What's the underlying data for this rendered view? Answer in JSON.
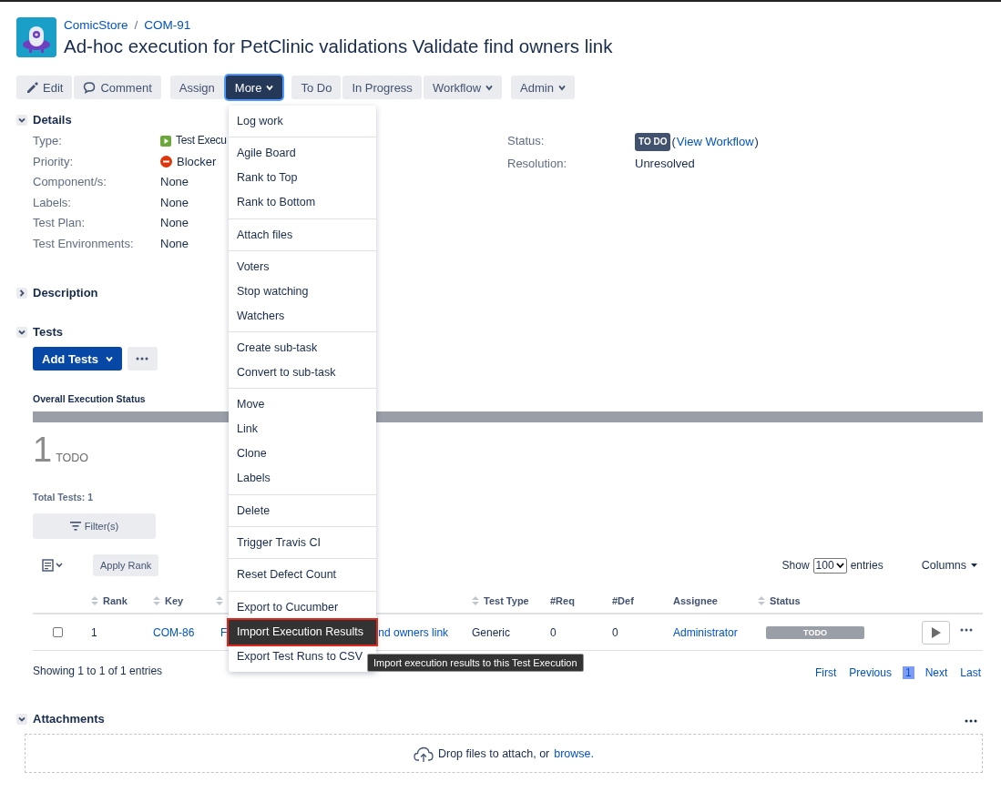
{
  "breadcrumb": [
    "ComicStore",
    "/",
    "COM-91"
  ],
  "title": "Ad-hoc execution for PetClinic validations Validate find owners link",
  "toolbar": [
    [
      {
        "label": "Edit",
        "kind": "edit",
        "selected": false
      },
      {
        "label": "Comment",
        "kind": "comment",
        "selected": false
      }
    ],
    [
      {
        "label": "Assign",
        "kind": "plain",
        "selected": false
      },
      {
        "label": "More",
        "kind": "dropdown",
        "selected": true
      }
    ],
    [
      {
        "label": "To Do",
        "kind": "plain",
        "selected": false
      },
      {
        "label": "In Progress",
        "kind": "plain",
        "selected": false
      },
      {
        "label": "Workflow",
        "kind": "dropdown",
        "selected": false
      }
    ],
    [
      {
        "label": "Admin",
        "kind": "dropdown",
        "selected": false
      }
    ]
  ],
  "details": {
    "title": "Details",
    "expanded": true,
    "fields": [
      {
        "label": "Type:",
        "kind": "test-execution",
        "value": "Test Execu"
      },
      {
        "label": "Priority:",
        "kind": "blocker",
        "value": "Blocker"
      },
      {
        "label": "Component/s:",
        "kind": "plain",
        "value": "None"
      },
      {
        "label": "Labels:",
        "kind": "plain",
        "value": "None"
      },
      {
        "label": "Test Plan:",
        "kind": "plain",
        "value": "None"
      },
      {
        "label": "Test Environments:",
        "kind": "plain",
        "value": "None"
      }
    ],
    "side_fields": [
      {
        "label": "Status:",
        "kind": "status",
        "lozenge": "TO DO",
        "open": "(",
        "link": "View Workflow",
        "close": ")"
      },
      {
        "label": "Resolution:",
        "kind": "plain",
        "value": "Unresolved"
      }
    ]
  },
  "description": {
    "title": "Description",
    "expanded": false
  },
  "tests": {
    "title": "Tests",
    "expanded": true,
    "add_button": "Add Tests",
    "overall_label": "Overall Execution Status",
    "level": 1,
    "count": "1",
    "count_status": "TODO",
    "total": "Total Tests: 1",
    "filter_button": "Filter(s)",
    "apply_rank": "Apply Rank",
    "show_label": "Show",
    "page_size": "100",
    "entries_label": "entries",
    "columns_button": "Columns",
    "table": {
      "columns": [
        {
          "label": "Rank",
          "sortable": true
        },
        {
          "label": "Key",
          "sortable": true
        },
        {
          "sortable": true
        },
        {
          "label": "Test Type",
          "sortable": true
        },
        {
          "label": "#Req",
          "sortable": false
        },
        {
          "label": "#Def",
          "sortable": false
        },
        {
          "label": "Assignee",
          "sortable": false
        },
        {
          "label": "Status",
          "sortable": true
        }
      ],
      "rows": [
        {
          "checked": false,
          "rank": "1",
          "key": "COM-86",
          "summary_parts": [
            "F",
            "nd owners link"
          ],
          "test_type": "Generic",
          "req": "0",
          "def": "0",
          "assignee": "Administrator",
          "status": "TODO"
        }
      ]
    },
    "showing": "Showing 1 to 1 of 1 entries",
    "pagination": [
      {
        "label": "First",
        "selected": false
      },
      {
        "label": "Previous",
        "selected": false
      },
      {
        "label": "1",
        "selected": true
      },
      {
        "label": "Next",
        "selected": false
      },
      {
        "label": "Last",
        "selected": false
      }
    ]
  },
  "attachments": {
    "title": "Attachments",
    "expanded": true,
    "drop_text": "Drop files to attach, or",
    "browse_link": "browse."
  },
  "more_menu": {
    "groups": [
      [
        {
          "label": "Log work",
          "selected": false
        }
      ],
      [
        {
          "label": "Agile Board",
          "selected": false
        },
        {
          "label": "Rank to Top",
          "selected": false
        },
        {
          "label": "Rank to Bottom",
          "selected": false
        }
      ],
      [
        {
          "label": "Attach files",
          "selected": false
        }
      ],
      [
        {
          "label": "Voters",
          "selected": false
        },
        {
          "label": "Stop watching",
          "selected": false
        },
        {
          "label": "Watchers",
          "selected": false
        }
      ],
      [
        {
          "label": "Create sub-task",
          "selected": false
        },
        {
          "label": "Convert to sub-task",
          "selected": false
        }
      ],
      [
        {
          "label": "Move",
          "selected": false
        },
        {
          "label": "Link",
          "selected": false
        },
        {
          "label": "Clone",
          "selected": false
        },
        {
          "label": "Labels",
          "selected": false
        }
      ],
      [
        {
          "label": "Delete",
          "selected": false
        }
      ],
      [
        {
          "label": "Trigger Travis CI",
          "selected": false
        }
      ],
      [
        {
          "label": "Reset Defect Count",
          "selected": false
        }
      ],
      [
        {
          "label": "Export to Cucumber",
          "selected": false
        },
        {
          "label": "Import Execution Results",
          "selected": true
        },
        {
          "label": "Export Test Runs to CSV",
          "selected": false
        }
      ]
    ],
    "tooltip": "Import execution results to this Test Execution"
  }
}
